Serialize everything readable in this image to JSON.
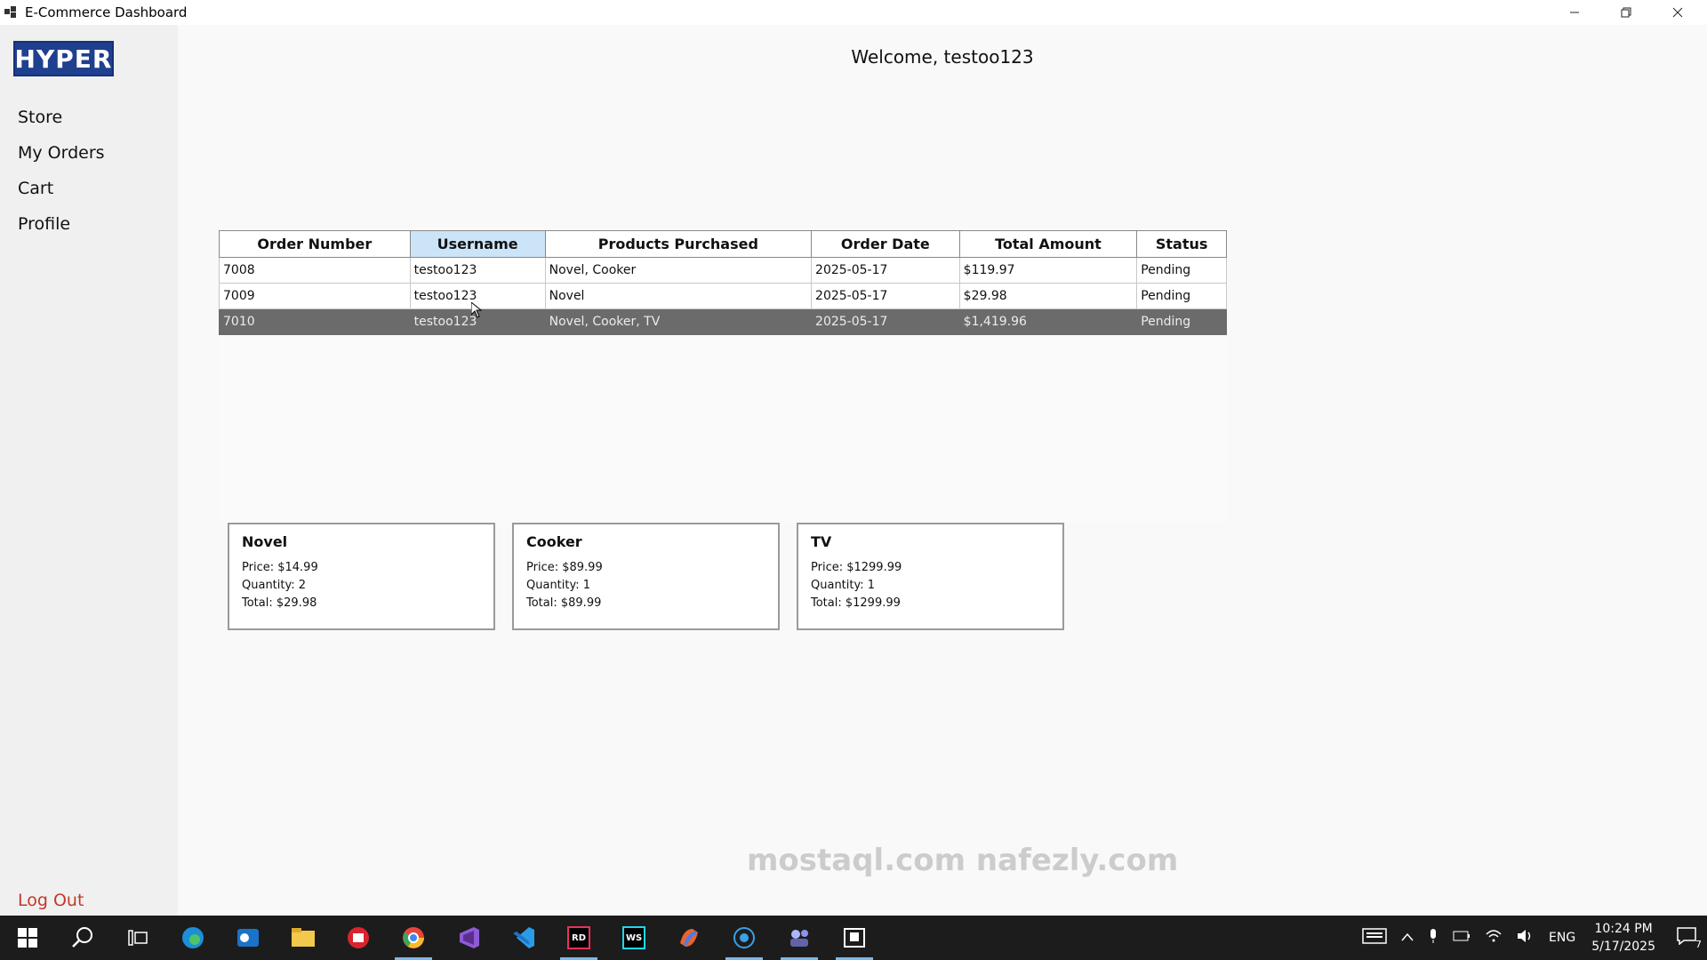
{
  "window": {
    "title": "E-Commerce Dashboard"
  },
  "sidebar": {
    "logo": "HYPER",
    "items": [
      {
        "label": "Store"
      },
      {
        "label": "My Orders"
      },
      {
        "label": "Cart"
      },
      {
        "label": "Profile"
      }
    ],
    "logout": "Log Out"
  },
  "header": {
    "welcome": "Welcome, testoo123"
  },
  "orders": {
    "columns": [
      "Order Number",
      "Username",
      "Products Purchased",
      "Order Date",
      "Total Amount",
      "Status"
    ],
    "selected_column": "Username",
    "rows": [
      [
        "7008",
        "testoo123",
        "Novel, Cooker",
        "2025-05-17",
        "$119.97",
        "Pending"
      ],
      [
        "7009",
        "testoo123",
        "Novel",
        "2025-05-17",
        "$29.98",
        "Pending"
      ],
      [
        "7010",
        "testoo123",
        "Novel, Cooker, TV",
        "2025-05-17",
        "$1,419.96",
        "Pending"
      ]
    ],
    "selected_row": "7010"
  },
  "items": [
    {
      "name": "Novel",
      "price": "Price: $14.99",
      "quantity": "Quantity: 2",
      "total": "Total: $29.98"
    },
    {
      "name": "Cooker",
      "price": "Price: $89.99",
      "quantity": "Quantity: 1",
      "total": "Total: $89.99"
    },
    {
      "name": "TV",
      "price": "Price: $1299.99",
      "quantity": "Quantity: 1",
      "total": "Total: $1299.99"
    }
  ],
  "taskbar": {
    "language": "ENG",
    "time": "10:24 PM",
    "date": "5/17/2025",
    "notifications": "7",
    "icons": [
      "windows-start-icon",
      "search-icon",
      "task-view-icon",
      "edge-icon",
      "outlook-icon",
      "file-explorer-icon",
      "app-red-icon",
      "chrome-icon",
      "visual-studio-icon",
      "vscode-icon",
      "rider-icon",
      "webstorm-icon",
      "copilot-icon",
      "app-gear-icon",
      "teams-icon",
      "app-window-icon"
    ]
  },
  "watermark": "mostaql.com nafezly.com"
}
